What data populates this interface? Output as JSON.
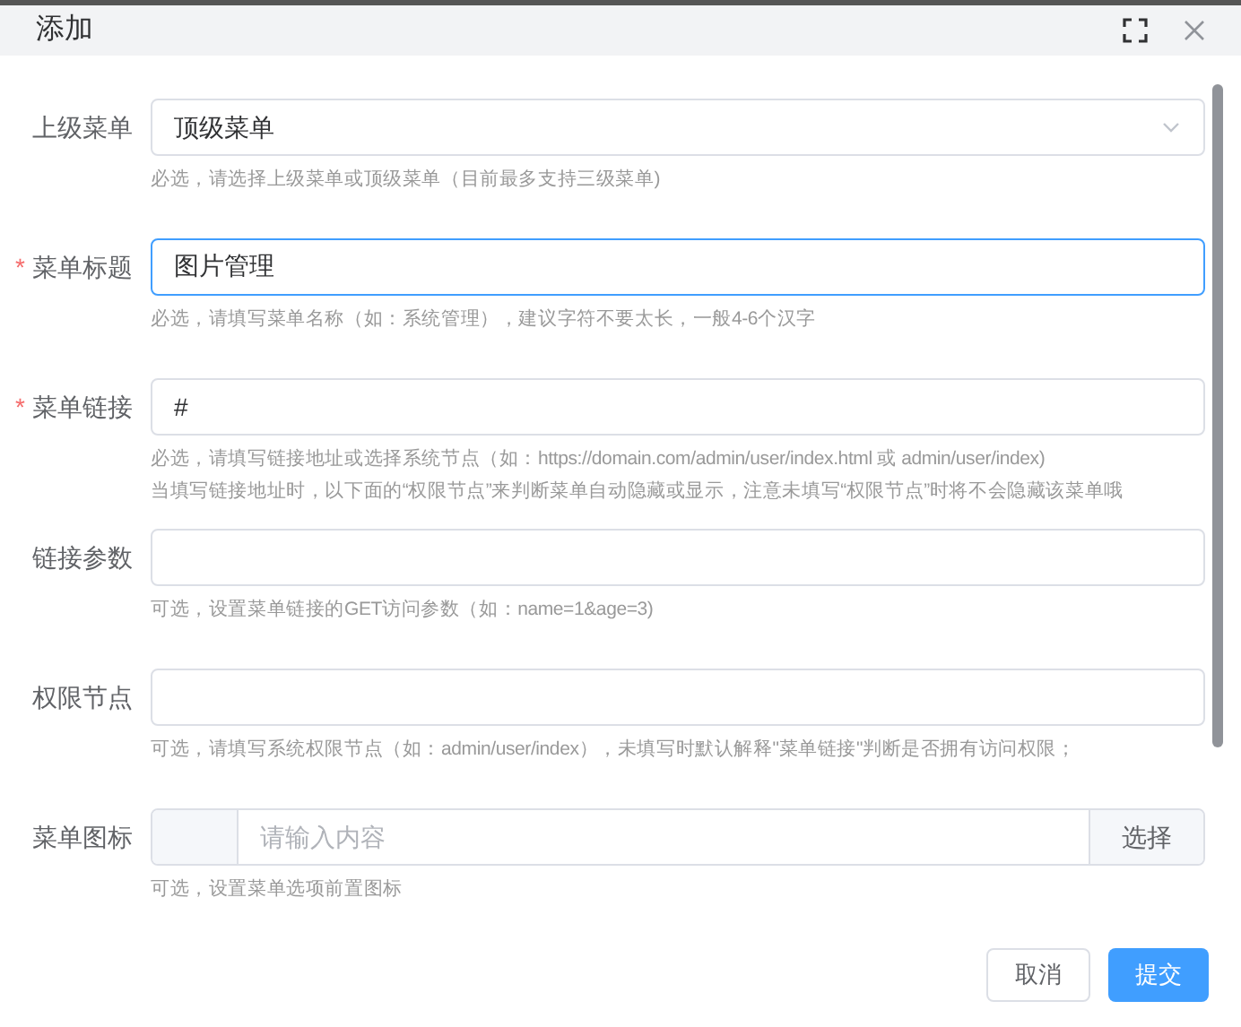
{
  "dialog": {
    "title": "添加"
  },
  "fields": [
    {
      "kind": "select",
      "label": "上级菜单",
      "focused": false,
      "value": "顶级菜单",
      "hints": [
        "必选，请选择上级菜单或顶级菜单（目前最多支持三级菜单)"
      ]
    },
    {
      "kind": "input",
      "label": "菜单标题",
      "required_mark": "*",
      "focused": true,
      "value": "图片管理",
      "hints": [
        "必选，请填写菜单名称（如：系统管理），建议字符不要太长，一般4-6个汉字"
      ]
    },
    {
      "kind": "input",
      "label": "菜单链接",
      "required_mark": "*",
      "focused": false,
      "value": "#",
      "hints": [
        "必选，请填写链接地址或选择系统节点（如：https://domain.com/admin/user/index.html 或 admin/user/index)",
        "当填写链接地址时，以下面的“权限节点”来判断菜单自动隐藏或显示，注意未填写“权限节点”时将不会隐藏该菜单哦"
      ]
    },
    {
      "kind": "input",
      "label": "链接参数",
      "focused": false,
      "hints": [
        "可选，设置菜单链接的GET访问参数（如：name=1&age=3)"
      ]
    },
    {
      "kind": "input",
      "label": "权限节点",
      "focused": false,
      "hints": [
        "可选，请填写系统权限节点（如：admin/user/index），未填写时默认解释\"菜单链接\"判断是否拥有访问权限；"
      ]
    },
    {
      "kind": "icon-picker",
      "label": "菜单图标",
      "focused": false,
      "placeholder": "请输入内容",
      "button": "选择",
      "hints": [
        "可选，设置菜单选项前置图标"
      ]
    }
  ],
  "buttons": [
    {
      "label": "取消",
      "primary": false
    },
    {
      "label": "提交",
      "primary": true
    }
  ]
}
